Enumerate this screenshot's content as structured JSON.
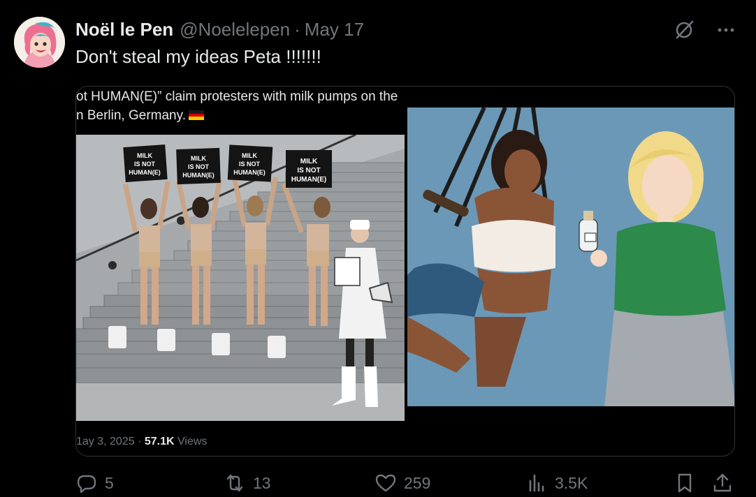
{
  "author": {
    "display_name": "Noël le Pen",
    "handle": "@Noelelepen",
    "separator": "·",
    "date": "May 17"
  },
  "tweet": {
    "text": "Don't steal my ideas Peta !!!!!!!"
  },
  "media_left": {
    "caption_line_1": "ot HUMAN(E)” claim protesters with milk pumps on the",
    "caption_line_2": "n Berlin, Germany.",
    "signs": [
      [
        "MILK",
        "IS NOT",
        "HUMAN(E)"
      ],
      [
        "MILK",
        "IS NOT",
        "HUMAN(E)"
      ],
      [
        "MILK",
        "IS NOT",
        "HUMAN(E)"
      ],
      [
        "MILK",
        "IS NOT",
        "HUMAN(E)"
      ]
    ],
    "meta_date": "1ay 3, 2025",
    "meta_separator": "·",
    "meta_views_count": "57.1K",
    "meta_views_label": "Views"
  },
  "actions": {
    "replies": "5",
    "reposts": "13",
    "likes": "259",
    "views": "3.5K"
  },
  "icons": {
    "grok": "slashed-circle-icon",
    "more": "more-dots-icon",
    "reply": "reply-bubble-icon",
    "repost": "repost-arrows-icon",
    "like": "heart-icon",
    "views": "bar-chart-icon",
    "bookmark": "bookmark-icon",
    "share": "share-upload-icon"
  },
  "colors": {
    "background": "#000000",
    "text_primary": "#e7e9ea",
    "text_secondary": "#71767b",
    "border": "#2f3336",
    "illustration_bg": "#6b98b6"
  }
}
